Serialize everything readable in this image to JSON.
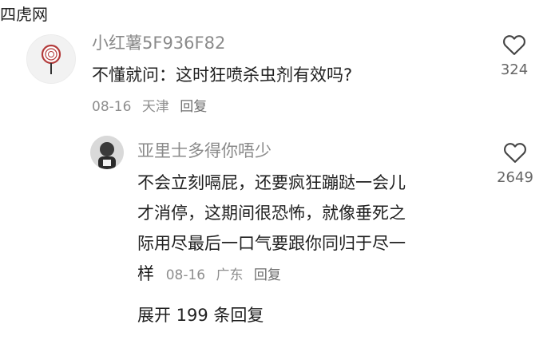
{
  "watermark": "四虎网",
  "comment": {
    "author": "小红薯5F936F82",
    "text": "不懂就问：这时狂喷杀虫剂有效吗?",
    "date": "08-16",
    "location": "天津",
    "reply_label": "回复",
    "likes": "324"
  },
  "reply": {
    "author": "亚里士多得你唔少",
    "lines": [
      "不会立刻嗝屁，还要疯狂蹦跶一会儿",
      "才消停，这期间很恐怖，就像垂死之",
      "际用尽最后一口气要跟你同归于尽一",
      "样"
    ],
    "date": "08-16",
    "location": "广东",
    "reply_label": "回复",
    "likes": "2649"
  },
  "expand_label": "展开 199 条回复",
  "colors": {
    "text": "#1f1f1f",
    "muted": "#8a8a8a"
  },
  "icons": {
    "like": "heart-outline-icon"
  }
}
